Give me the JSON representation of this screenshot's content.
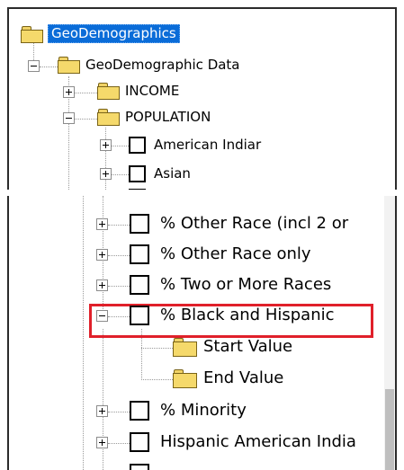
{
  "top_tree": {
    "root_label": "GeoDemographics",
    "geodemographic_data_label": "GeoDemographic Data",
    "income_label": "INCOME",
    "population_label": "POPULATION",
    "american_indian_label": "American Indiar",
    "asian_label": "Asian"
  },
  "bottom_tree": {
    "items": [
      {
        "label": "% Other Race (incl 2 or"
      },
      {
        "label": "% Other Race only"
      },
      {
        "label": "% Two or More Races"
      },
      {
        "label": "% Black and Hispanic"
      },
      {
        "label": "Start Value"
      },
      {
        "label": "End Value"
      },
      {
        "label": "% Minority"
      },
      {
        "label": "Hispanic American India"
      }
    ]
  },
  "icons": {
    "folder": "folder-icon",
    "checkbox": "checkbox-icon",
    "expand": "plus-box-icon",
    "collapse": "minus-box-icon"
  },
  "colors": {
    "selection": "#0a6cd8",
    "highlight_border": "#e0202a",
    "folder_fill": "#f5d96b"
  }
}
